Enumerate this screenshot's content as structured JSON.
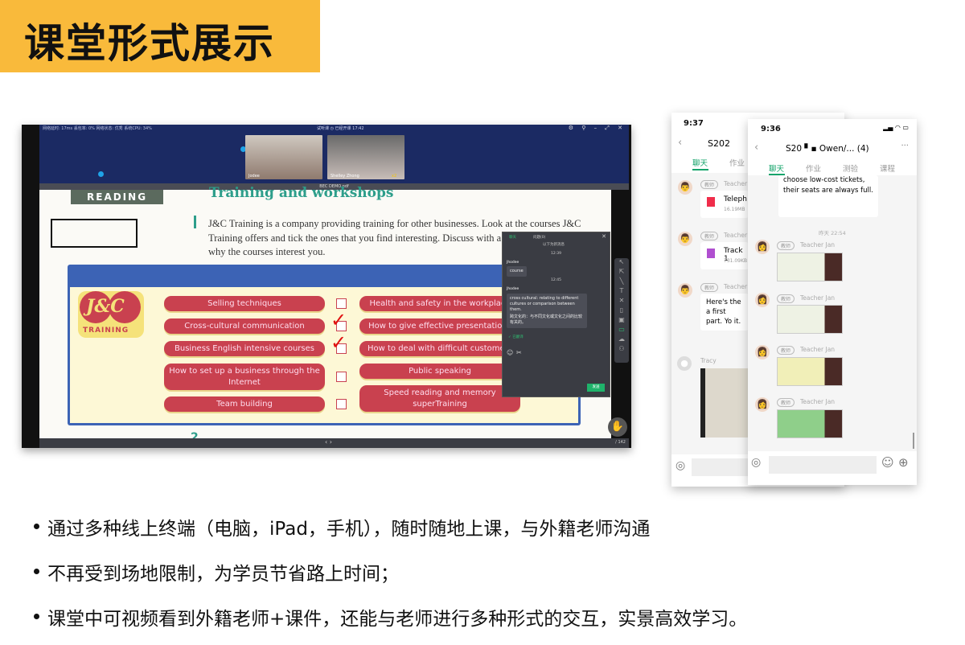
{
  "slide": {
    "title": "课堂形式展示",
    "bullets": [
      "通过多种线上终端（电脑，iPad，手机），随时随地上课，与外籍老师沟通",
      "不再受到场地限制，为学员节省路上时间；",
      "课堂中可视频看到外籍老师+课件，还能与老师进行多种形式的交互，实景高效学习。"
    ],
    "accent_color": "#F9BA3B"
  },
  "desktop": {
    "status_line": "网络延时: 17ms 丢包率: 0% 网络状态: 优秀 系统CPU: 34%",
    "class_info": "试听课 ◷ 已经开课 17:42",
    "window_controls": "⚙ ⚲ – ⤢ ✕",
    "cams": [
      {
        "name": "Jodee"
      },
      {
        "name": "Shelley Zhong",
        "trophies": "x2"
      }
    ],
    "pdf_title": "BEC DEMO.pdf",
    "page_indicator": "/ 142",
    "page": {
      "section": "READING",
      "title": "Training and workshops",
      "paragraph": "J&C Training is a company providing training for other businesses. Look at the courses J&C Training offers and tick the ones that you find interesting. Discuss with a partner and explain why the courses interest you.",
      "logo_text": "J&C",
      "logo_sub": "TRAINING",
      "left_items": [
        {
          "label": "Selling techniques",
          "checked": false
        },
        {
          "label": "Cross-cultural communication",
          "checked": true
        },
        {
          "label": "Business English intensive courses",
          "checked": true
        },
        {
          "label": "How to set up a business through the Internet",
          "checked": false
        },
        {
          "label": "Team building",
          "checked": false
        }
      ],
      "right_items": [
        "Health and safety in the workplace",
        "How to give effective presentations",
        "How to deal with difficult customers",
        "Public speaking",
        "Speed reading and memory superTraining"
      ],
      "next_heading": "2"
    },
    "chat": {
      "tabs": [
        "聊天",
        "问题(0)"
      ],
      "divider": "以下为新消息",
      "messages": [
        {
          "time": "12:39",
          "sender": "Jhodee",
          "text": "course"
        },
        {
          "time": "12:45",
          "sender": "Jhodee",
          "text": "cross cultural:  relating to different cultures or comparison between them.",
          "text_cn": "跨文化的：与不同文化或文化之间的比较有关的。"
        }
      ],
      "read_label": "✓ 已翻译",
      "send_label": "发送"
    }
  },
  "phone_back": {
    "time": "9:37",
    "group": "S202",
    "tabs": [
      "聊天",
      "作业"
    ],
    "messages": [
      {
        "badge": "教师",
        "sender": "Teacher",
        "file": "Teleph",
        "size": "16.19MB"
      },
      {
        "badge": "教师",
        "sender": "Teacher",
        "file": "Track 1",
        "size": "731.09KB"
      },
      {
        "badge": "教师",
        "sender": "Teacher",
        "text": "Here's the a first part. Yo it."
      },
      {
        "sender": "Tracy"
      }
    ]
  },
  "phone_front": {
    "time": "9:36",
    "group": "S20",
    "group_suffix": "Owen/... (4)",
    "tabs": [
      "聊天",
      "作业",
      "测验",
      "课程"
    ],
    "prev_text": "choose low-cost tickets, their seats are always full.",
    "timestamp": "昨天 22:54",
    "messages": [
      {
        "badge": "教师",
        "sender": "Teacher Jan"
      },
      {
        "badge": "教师",
        "sender": "Teacher Jan"
      },
      {
        "badge": "教师",
        "sender": "Teacher Jan"
      },
      {
        "badge": "教师",
        "sender": "Teacher Jan"
      }
    ]
  }
}
